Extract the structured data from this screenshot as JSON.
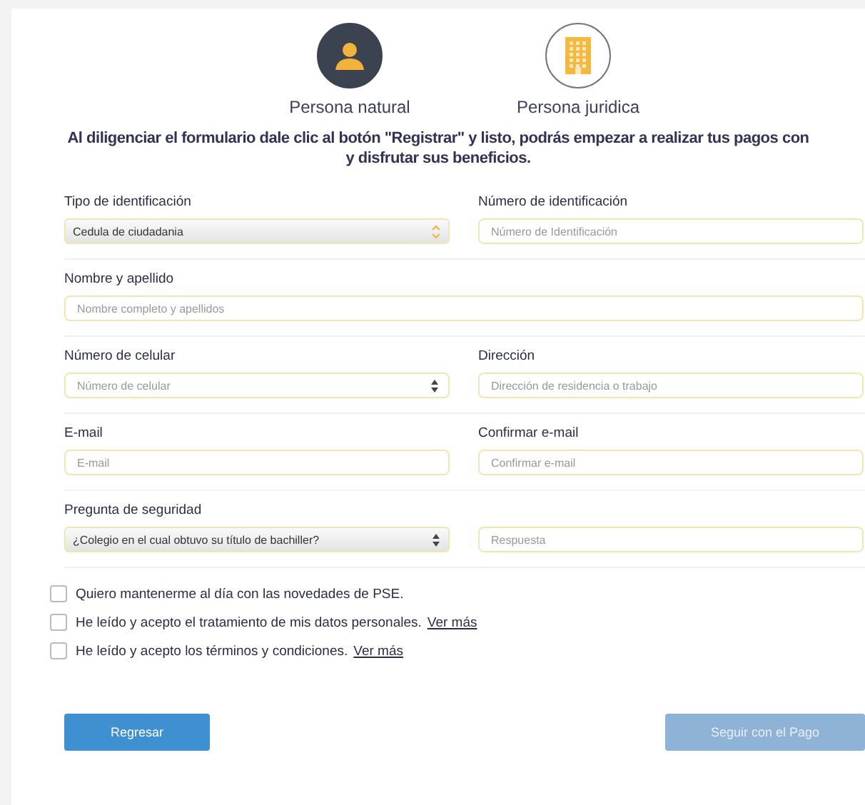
{
  "person_types": [
    {
      "label": "Persona natural",
      "kind": "person",
      "selected": true
    },
    {
      "label": "Persona juridica",
      "kind": "building",
      "selected": false
    }
  ],
  "intro": [
    "Al diligenciar el formulario dale clic al botón \"Registrar\" y listo, podrás empezar a realizar tus pagos con",
    "y disfrutar sus beneficios."
  ],
  "rows": [
    {
      "fields": [
        {
          "label": "Tipo de identificación",
          "kind": "select",
          "value": "Cedula de ciudadania"
        },
        {
          "label": "Número de identificación",
          "kind": "input",
          "placeholder": "Número de Identificación"
        }
      ]
    },
    {
      "fields": [
        {
          "label": "Nombre y apellido",
          "kind": "input",
          "placeholder": "Nombre completo y apellidos"
        }
      ]
    },
    {
      "fields": [
        {
          "label": "Número de celular",
          "kind": "number",
          "placeholder": "Número de celular"
        },
        {
          "label": "Dirección",
          "kind": "input",
          "placeholder": "Dirección de residencia o trabajo"
        }
      ]
    },
    {
      "fields": [
        {
          "label": "E-mail",
          "kind": "input",
          "placeholder": "E-mail"
        },
        {
          "label": "Confirmar e-mail",
          "kind": "input",
          "placeholder": "Confirmar e-mail"
        }
      ]
    },
    {
      "fields": [
        {
          "label": "Pregunta de seguridad",
          "kind": "select",
          "value": "¿Colegio en el cual obtuvo su título de bachiller?"
        },
        {
          "kind": "input",
          "placeholder": "Respuesta"
        }
      ]
    }
  ],
  "checkboxes": [
    {
      "label": "Quiero mantenerme al día con las novedades de PSE.",
      "checked": false
    },
    {
      "label": "He leído y acepto el tratamiento de mis datos personales.",
      "link": "Ver más",
      "checked": false
    },
    {
      "label": "He leído y acepto los términos y condiciones.",
      "link": "Ver más",
      "checked": false
    }
  ],
  "buttons": [
    {
      "label": "Regresar",
      "disabled": false
    },
    {
      "label": "Seguir con el Pago",
      "disabled": true
    }
  ]
}
